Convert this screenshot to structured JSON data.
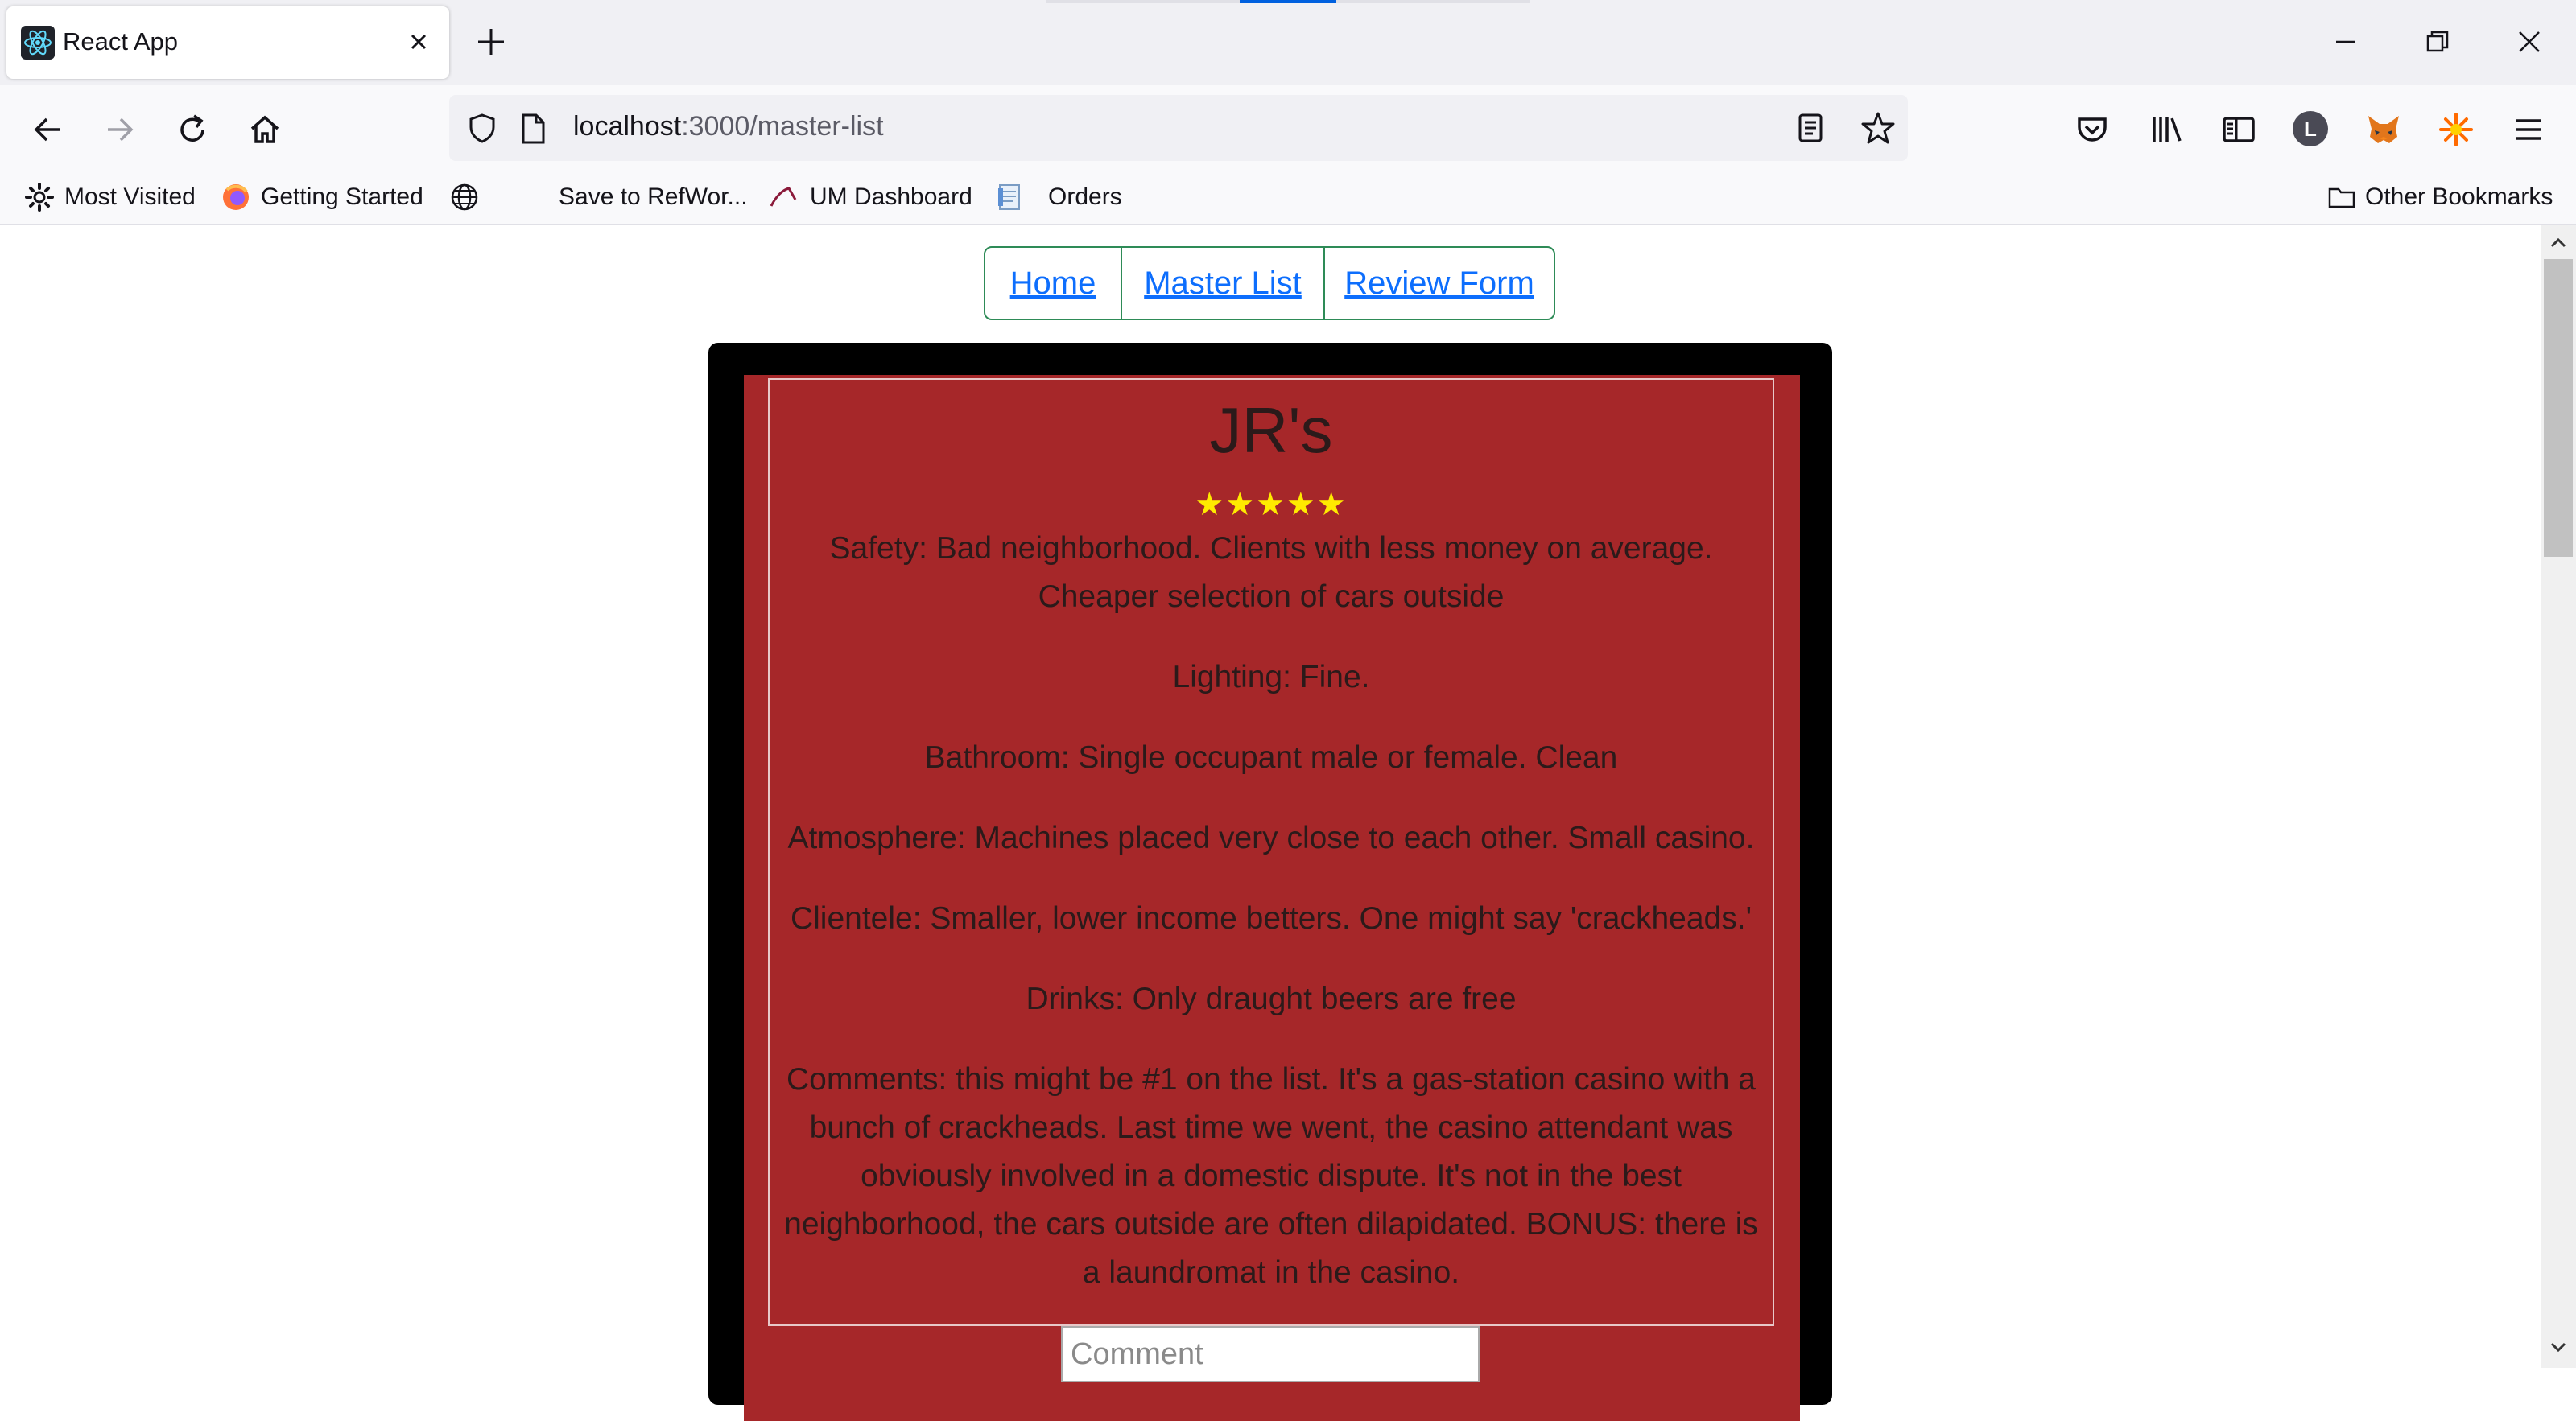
{
  "browser": {
    "tab_title": "React App",
    "url_host": "localhost",
    "url_rest": ":3000/master-list",
    "profile_initial": "L",
    "bookmarks": [
      "Most Visited",
      "Getting Started",
      "Save to RefWor...",
      "UM Dashboard",
      "Orders"
    ],
    "other_bookmarks": "Other Bookmarks"
  },
  "nav": {
    "home": "Home",
    "master_list": "Master List",
    "review_form": "Review Form"
  },
  "review": {
    "name": "JR's",
    "rating_stars": 5,
    "stars_text": "★★★★★",
    "star_color": "#ffea00",
    "card_color": "#a62729",
    "safety": "Safety: Bad neighborhood. Clients with less money on average. Cheaper selection of cars outside",
    "lighting": "Lighting: Fine.",
    "bathroom": "Bathroom: Single occupant male or female. Clean",
    "atmosphere": "Atmosphere: Machines placed very close to each other. Small casino.",
    "clientele": "Clientele: Smaller, lower income betters. One might say 'crackheads.'",
    "drinks": "Drinks: Only draught beers are free",
    "comments": "Comments: this might be #1 on the list. It's a gas-station casino with a bunch of crackheads. Last time we went, the casino attendant was obviously involved in a domestic dispute. It's not in the best neighborhood, the cars outside are often dilapidated. BONUS: there is a laundromat in the casino."
  },
  "comment_input": {
    "placeholder": "Comment",
    "value": ""
  }
}
